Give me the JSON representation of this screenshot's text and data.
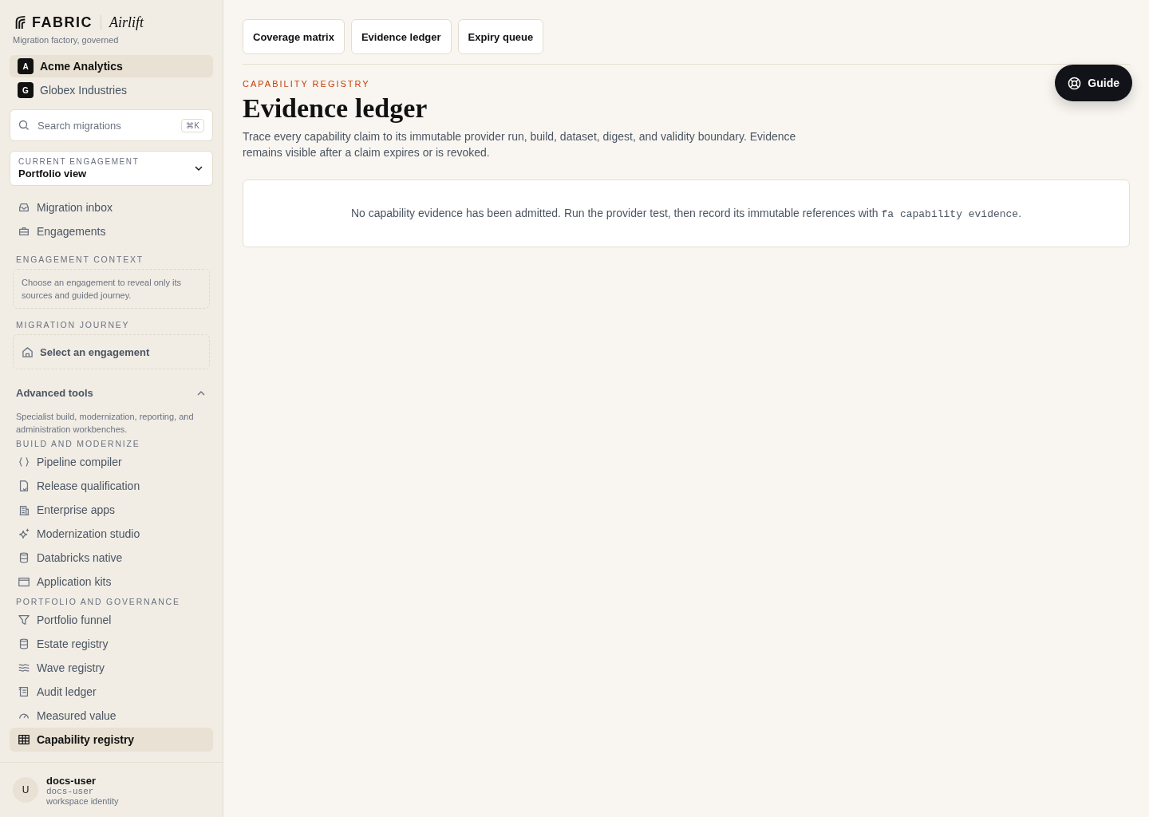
{
  "brand": {
    "logo": "FABRIC",
    "product": "Airlift",
    "tagline": "Migration factory, governed"
  },
  "workspaces": [
    {
      "initial": "A",
      "name": "Acme Analytics",
      "selected": true
    },
    {
      "initial": "G",
      "name": "Globex Industries",
      "selected": false
    }
  ],
  "search": {
    "placeholder": "Search migrations",
    "shortcut": "⌘K"
  },
  "engagement_select": {
    "label": "CURRENT ENGAGEMENT",
    "value": "Portfolio view"
  },
  "primary_nav": [
    {
      "label": "Migration inbox",
      "selected": false
    },
    {
      "label": "Engagements",
      "selected": false
    }
  ],
  "engagement_context": {
    "heading": "ENGAGEMENT CONTEXT",
    "note": "Choose an engagement to reveal only its sources and guided journey."
  },
  "migration_journey": {
    "heading": "MIGRATION JOURNEY",
    "item": "Select an engagement"
  },
  "advanced_tools": {
    "label": "Advanced tools",
    "expanded": true,
    "description": "Specialist build, modernization, reporting, and administration workbenches.",
    "sections": [
      {
        "heading": "BUILD AND MODERNIZE",
        "items": [
          {
            "label": "Pipeline compiler",
            "selected": false
          },
          {
            "label": "Release qualification",
            "selected": false
          },
          {
            "label": "Enterprise apps",
            "selected": false
          },
          {
            "label": "Modernization studio",
            "selected": false
          },
          {
            "label": "Databricks native",
            "selected": false
          },
          {
            "label": "Application kits",
            "selected": false
          }
        ]
      },
      {
        "heading": "PORTFOLIO AND GOVERNANCE",
        "items": [
          {
            "label": "Portfolio funnel",
            "selected": false
          },
          {
            "label": "Estate registry",
            "selected": false
          },
          {
            "label": "Wave registry",
            "selected": false
          },
          {
            "label": "Audit ledger",
            "selected": false
          },
          {
            "label": "Measured value",
            "selected": false
          },
          {
            "label": "Capability registry",
            "selected": true
          }
        ]
      }
    ]
  },
  "user": {
    "initial": "U",
    "name": "docs-user",
    "handle": "docs-user",
    "role": "workspace identity"
  },
  "tabs": [
    {
      "label": "Coverage matrix",
      "selected": false
    },
    {
      "label": "Evidence ledger",
      "selected": false
    },
    {
      "label": "Expiry queue",
      "selected": false
    }
  ],
  "page": {
    "eyebrow": "CAPABILITY REGISTRY",
    "title": "Evidence ledger",
    "description": "Trace every capability claim to its immutable provider run, build, dataset, digest, and validity boundary. Evidence remains visible after a claim expires or is revoked."
  },
  "empty_state": {
    "text_before": "No capability evidence has been admitted. Run the provider test, then record its immutable references with",
    "command": "fa capability evidence",
    "text_after": "."
  },
  "guide_button": {
    "label": "Guide"
  }
}
